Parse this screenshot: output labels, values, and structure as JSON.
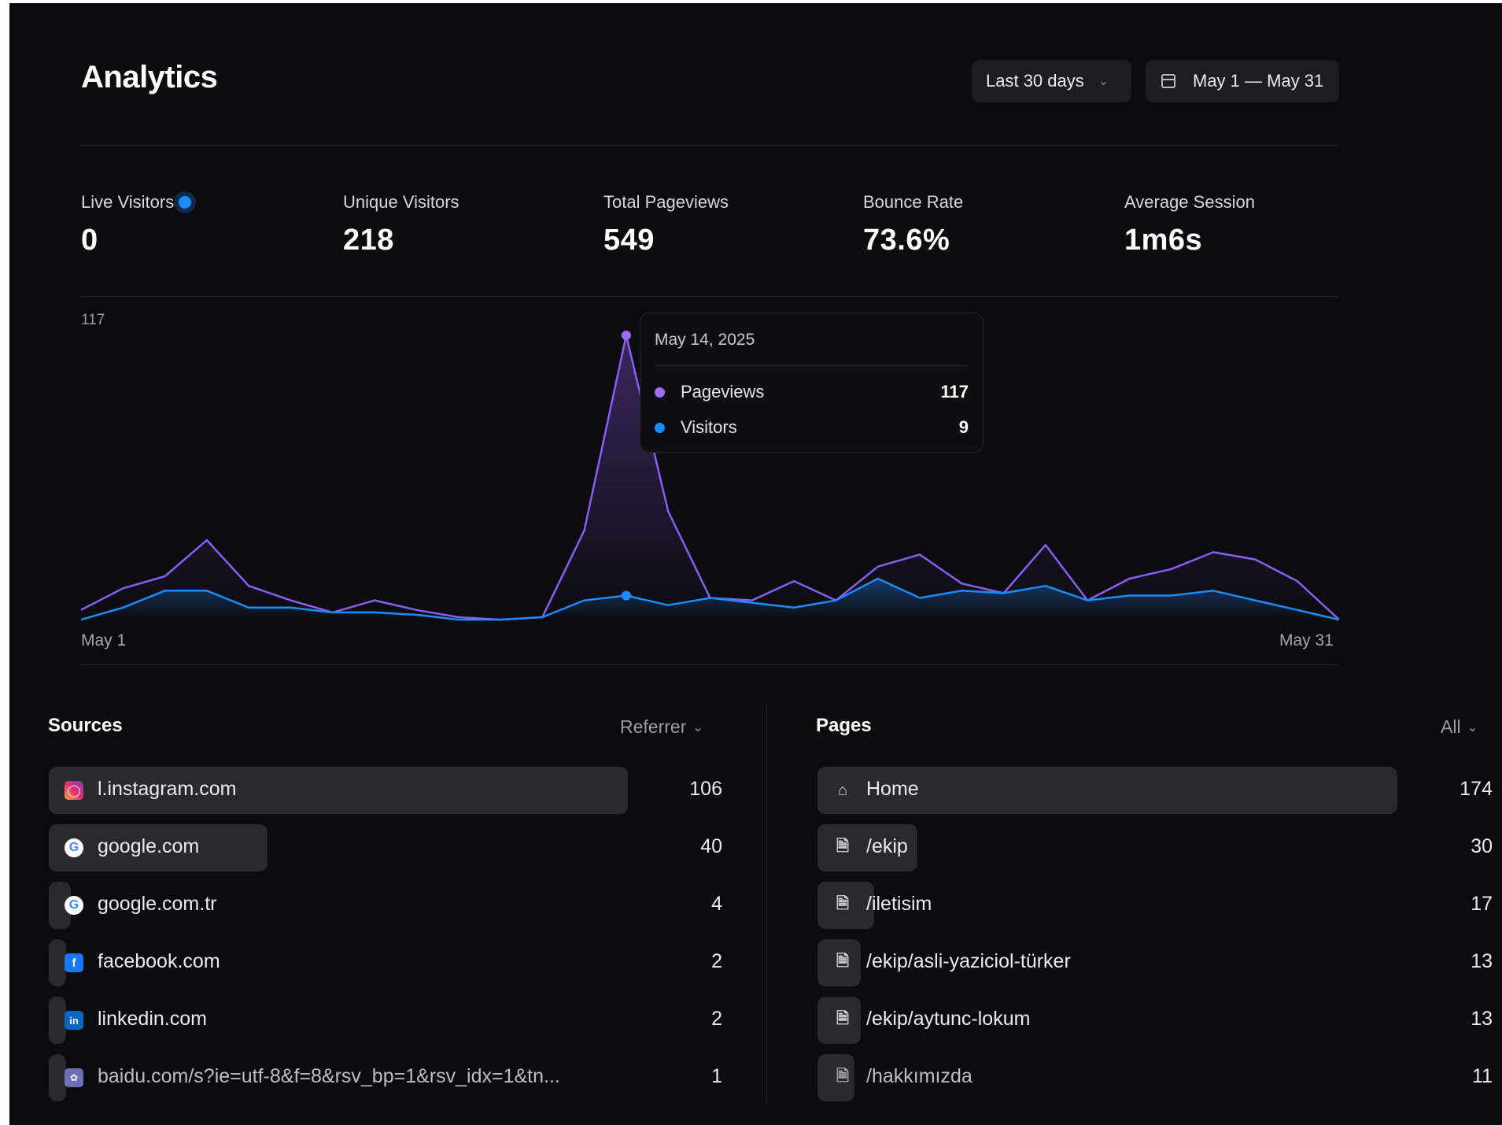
{
  "header": {
    "title": "Analytics",
    "range_label": "Last 30 days",
    "date_label": "May 1 — May 31"
  },
  "stats": [
    {
      "label": "Live Visitors",
      "value": "0"
    },
    {
      "label": "Unique Visitors",
      "value": "218"
    },
    {
      "label": "Total Pageviews",
      "value": "549"
    },
    {
      "label": "Bounce Rate",
      "value": "73.6%"
    },
    {
      "label": "Average Session",
      "value": "1m6s"
    }
  ],
  "chart_data": {
    "type": "area",
    "y_max_label": "117",
    "x_start_label": "May 1",
    "x_end_label": "May 31",
    "ylim": [
      0,
      117
    ],
    "x": [
      1,
      2,
      3,
      4,
      5,
      6,
      7,
      8,
      9,
      10,
      11,
      12,
      13,
      14,
      15,
      16,
      17,
      18,
      19,
      20,
      21,
      22,
      23,
      24,
      25,
      26,
      27,
      28,
      29,
      30,
      31
    ],
    "series": [
      {
        "name": "Pageviews",
        "color": "#8b5cf6",
        "values": [
          3,
          12,
          17,
          32,
          13,
          7,
          2,
          7,
          3,
          0,
          -1,
          0,
          36,
          117,
          44,
          8,
          7,
          15,
          7,
          21,
          26,
          14,
          10,
          30,
          7,
          16,
          20,
          27,
          24,
          15,
          -1
        ]
      },
      {
        "name": "Visitors",
        "color": "#1a8cff",
        "values": [
          -1,
          4,
          11,
          11,
          4,
          4,
          2,
          2,
          1,
          -1,
          -1,
          0,
          7,
          9,
          5,
          8,
          6,
          4,
          7,
          16,
          8,
          11,
          10,
          13,
          7,
          9,
          9,
          11,
          7,
          3,
          -1
        ]
      }
    ],
    "tooltip": {
      "date": "May 14, 2025",
      "rows": [
        {
          "label": "Pageviews",
          "value": "117",
          "color": "#a06bf5"
        },
        {
          "label": "Visitors",
          "value": "9",
          "color": "#1a8cff"
        }
      ]
    }
  },
  "sources": {
    "title": "Sources",
    "filter": "Referrer",
    "items": [
      {
        "name": "l.instagram.com",
        "count": "106",
        "value": 106,
        "icon": "instagram-icon"
      },
      {
        "name": "google.com",
        "count": "40",
        "value": 40,
        "icon": "google-icon"
      },
      {
        "name": "google.com.tr",
        "count": "4",
        "value": 4,
        "icon": "google-icon"
      },
      {
        "name": "facebook.com",
        "count": "2",
        "value": 2,
        "icon": "facebook-icon"
      },
      {
        "name": "linkedin.com",
        "count": "2",
        "value": 2,
        "icon": "linkedin-icon"
      },
      {
        "name": "baidu.com/s?ie=utf-8&f=8&rsv_bp=1&rsv_idx=1&tn...",
        "count": "1",
        "value": 1,
        "icon": "baidu-icon"
      }
    ]
  },
  "pages": {
    "title": "Pages",
    "filter": "All",
    "items": [
      {
        "name": "Home",
        "count": "174",
        "value": 174,
        "icon": "home-icon"
      },
      {
        "name": "/ekip",
        "count": "30",
        "value": 30,
        "icon": "file-icon"
      },
      {
        "name": "/iletisim",
        "count": "17",
        "value": 17,
        "icon": "file-icon"
      },
      {
        "name": "/ekip/asli-yaziciol-türker",
        "count": "13",
        "value": 13,
        "icon": "file-icon"
      },
      {
        "name": "/ekip/aytunc-lokum",
        "count": "13",
        "value": 13,
        "icon": "file-icon"
      },
      {
        "name": "/hakkımızda",
        "count": "11",
        "value": 11,
        "icon": "file-icon"
      }
    ]
  }
}
